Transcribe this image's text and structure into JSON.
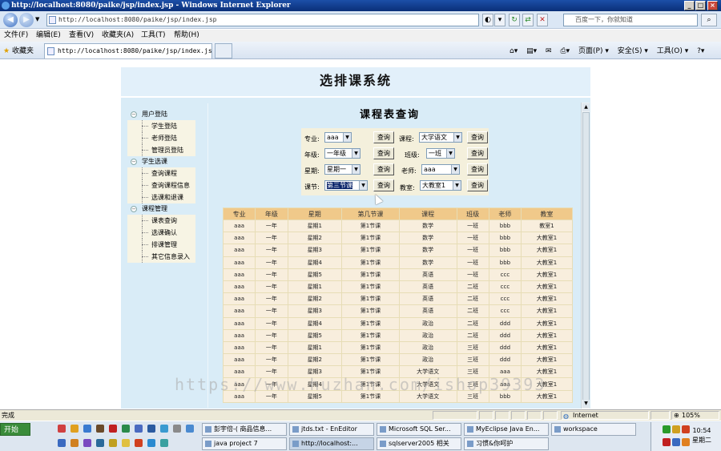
{
  "window": {
    "title": "http://localhost:8080/paike/jsp/index.jsp - Windows Internet Explorer",
    "controls": [
      "_",
      "□",
      "×"
    ]
  },
  "addressbar": {
    "url": "http://localhost:8080/paike/jsp/index.jsp",
    "search_placeholder": "百度一下，你就知道"
  },
  "menu": [
    "文件(F)",
    "编辑(E)",
    "查看(V)",
    "收藏夹(A)",
    "工具(T)",
    "帮助(H)"
  ],
  "favorites": {
    "label": "收藏夹",
    "tab_title": "http://localhost:8080/paike/jsp/index.jsp",
    "commands": [
      "页面(P) ▾",
      "安全(S) ▾",
      "工具(O) ▾"
    ]
  },
  "page": {
    "system_title": "选排课系统",
    "sidebar": [
      {
        "group": "用户登陆",
        "items": [
          "学生登陆",
          "老师登陆",
          "管理员登陆"
        ]
      },
      {
        "group": "学生选课",
        "items": [
          "查询课程",
          "查询课程信息",
          "选课和退课"
        ]
      },
      {
        "group": "课程管理",
        "items": [
          "课表查询",
          "选课确认",
          "排课管理",
          "其它信息录入"
        ]
      }
    ],
    "query_title": "课程表查询",
    "query_button": "查询",
    "filters": {
      "major": {
        "label": "专业:",
        "value": "aaa"
      },
      "course": {
        "label": "课程:",
        "value": "大学语文"
      },
      "grade": {
        "label": "年级:",
        "value": "一年级"
      },
      "class": {
        "label": "班级:",
        "value": "一班"
      },
      "weekday": {
        "label": "星期:",
        "value": "星期一"
      },
      "teacher": {
        "label": "老师:",
        "value": "aaa"
      },
      "section": {
        "label": "课节:",
        "value": "第三节课"
      },
      "room": {
        "label": "教室:",
        "value": "大教室1"
      }
    },
    "table": {
      "headers": [
        "专业",
        "年级",
        "星期",
        "第几节课",
        "课程",
        "班级",
        "老师",
        "教室"
      ],
      "rows": [
        [
          "aaa",
          "一年",
          "星期1",
          "第1节课",
          "数学",
          "一班",
          "bbb",
          "教室1"
        ],
        [
          "aaa",
          "一年",
          "星期2",
          "第1节课",
          "数学",
          "一班",
          "bbb",
          "大教室1"
        ],
        [
          "aaa",
          "一年",
          "星期3",
          "第1节课",
          "数学",
          "一班",
          "bbb",
          "大教室1"
        ],
        [
          "aaa",
          "一年",
          "星期4",
          "第1节课",
          "数学",
          "一班",
          "bbb",
          "大教室1"
        ],
        [
          "aaa",
          "一年",
          "星期5",
          "第1节课",
          "英语",
          "一班",
          "ccc",
          "大教室1"
        ],
        [
          "aaa",
          "一年",
          "星期1",
          "第1节课",
          "英语",
          "二班",
          "ccc",
          "大教室1"
        ],
        [
          "aaa",
          "一年",
          "星期2",
          "第1节课",
          "英语",
          "二班",
          "ccc",
          "大教室1"
        ],
        [
          "aaa",
          "一年",
          "星期3",
          "第1节课",
          "英语",
          "二班",
          "ccc",
          "大教室1"
        ],
        [
          "aaa",
          "一年",
          "星期4",
          "第1节课",
          "政治",
          "二班",
          "ddd",
          "大教室1"
        ],
        [
          "aaa",
          "一年",
          "星期5",
          "第1节课",
          "政治",
          "二班",
          "ddd",
          "大教室1"
        ],
        [
          "aaa",
          "一年",
          "星期1",
          "第1节课",
          "政治",
          "三班",
          "ddd",
          "大教室1"
        ],
        [
          "aaa",
          "一年",
          "星期2",
          "第1节课",
          "政治",
          "三班",
          "ddd",
          "大教室1"
        ],
        [
          "aaa",
          "一年",
          "星期3",
          "第1节课",
          "大学语文",
          "三班",
          "aaa",
          "大教室1"
        ],
        [
          "aaa",
          "一年",
          "星期4",
          "第1节课",
          "大学语文",
          "三班",
          "aaa",
          "大教室1"
        ],
        [
          "aaa",
          "一年",
          "星期5",
          "第1节课",
          "大学语文",
          "三班",
          "bbb",
          "大教室1"
        ]
      ]
    }
  },
  "watermark": "https://www.huzhan.com/ishop39393",
  "status": {
    "left": "完成",
    "zone": "Internet",
    "zoom": "105%"
  },
  "taskbar": {
    "start": "开始",
    "buttons_row1": [
      "彭宇倍-( 商品信息...",
      "jtds.txt - EnEditor",
      "Microsoft SQL Ser...",
      "MyEclipse Java En...",
      "workspace"
    ],
    "buttons_row2": [
      "java project 7",
      "http://localhost:...",
      "sqlserver2005 相关",
      "习惯&你呵护"
    ],
    "time": "10:54",
    "day": "星期二"
  }
}
